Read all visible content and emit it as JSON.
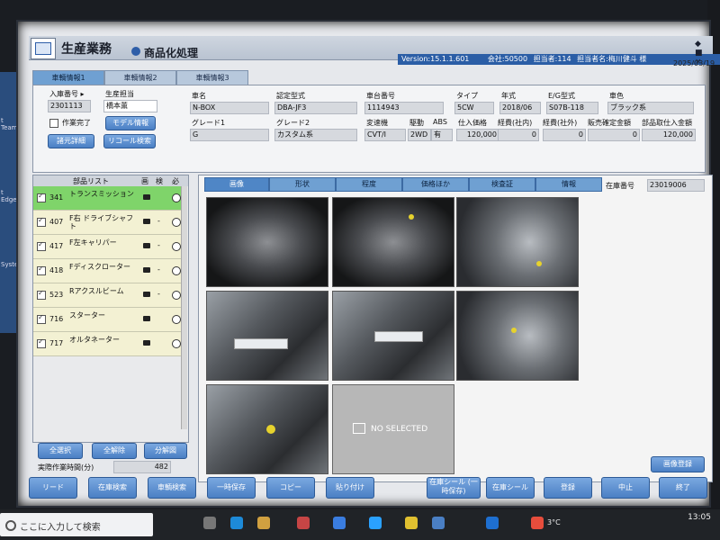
{
  "app": {
    "title": "生産業務",
    "subtitle": "商品化処理",
    "version": "Version:15.1.1.601",
    "company": "会社:50500",
    "staff_code": "担当者:114",
    "staff_name": "担当者名:梅川健斗 様",
    "window_controls": "◆ ■ ×",
    "date": "2025/03/19"
  },
  "top_tabs": [
    "車輌情報1",
    "車輌情報2",
    "車輌情報3"
  ],
  "left_info": {
    "inbound_no_label": "入庫番号 ▸",
    "inbound_no": "2301113",
    "production_staff_label": "生産担当",
    "production_staff": "橋本薫",
    "work_done_label": "作業完了",
    "model_info_button": "モデル情報",
    "detail_button": "諸元詳細",
    "recall_button": "リコール検索"
  },
  "vehicle": {
    "name_label": "車名",
    "name": "N-BOX",
    "cert_type_label": "認定型式",
    "cert_type": "DBA-JF3",
    "chassis_no_label": "車台番号",
    "chassis_no": "1114943",
    "type_label": "タイプ",
    "type": "5CW",
    "year_label": "年式",
    "year": "2018/06",
    "eg_type_label": "E/G型式",
    "eg_type": "S07B-118",
    "color_label": "車色",
    "color": "ブラック系",
    "grade1_label": "グレード1",
    "grade1": "G",
    "grade2_label": "グレード2",
    "grade2": "カスタム系",
    "mission_label": "変速機",
    "mission": "CVT/I",
    "drive_label": "駆動",
    "drive": "2WD",
    "abs_label": "ABS",
    "abs": "有",
    "purchase_label": "仕入価格",
    "purchase": "120,000",
    "cost_in_label": "経費(社内)",
    "cost_in": "0",
    "cost_out_label": "経費(社外)",
    "cost_out": "0",
    "sale_fixed_label": "販売確定金額",
    "sale_fixed": "0",
    "parts_total_label": "部品取仕入金額",
    "parts_total": "120,000"
  },
  "parts_list": {
    "header": "部品リスト",
    "col_img": "画",
    "col_check": "検",
    "col_must": "必",
    "rows": [
      {
        "code": "341",
        "name": "トランスミッション",
        "mark": "",
        "selected": true
      },
      {
        "code": "407",
        "name": "F右 ドライブシャフト",
        "mark": "-",
        "selected": false
      },
      {
        "code": "417",
        "name": "F左キャリパー",
        "mark": "-",
        "selected": false
      },
      {
        "code": "418",
        "name": "Fディスクローター",
        "mark": "-",
        "selected": false
      },
      {
        "code": "523",
        "name": "Rアクスルビーム",
        "mark": "-",
        "selected": false
      },
      {
        "code": "716",
        "name": "スターター",
        "mark": "",
        "selected": false
      },
      {
        "code": "717",
        "name": "オルタネーター",
        "mark": "",
        "selected": false
      }
    ],
    "select_all": "全選択",
    "deselect_all": "全解除",
    "split": "分解図",
    "work_time_label": "実際作業時間(分)",
    "work_time": "482"
  },
  "image_tabs": [
    "画像",
    "形状",
    "程度",
    "価格ほか",
    "検査証",
    "情報"
  ],
  "stock_no_label": "在庫番号",
  "stock_no": "23019006",
  "no_selected": "NO SELECTED",
  "image_register": "画像登録",
  "bottom_buttons": [
    "リード",
    "在庫検索",
    "車輌検索",
    "一時保存",
    "コピー",
    "貼り付け",
    "在庫シール (一時保存)",
    "在庫シール",
    "登録",
    "中止",
    "終了"
  ],
  "taskbar": {
    "search": "ここに入力して検索",
    "temp": "3°C",
    "time": "13:05"
  },
  "desktop": [
    "t Team",
    "t Edge",
    "Syster"
  ]
}
